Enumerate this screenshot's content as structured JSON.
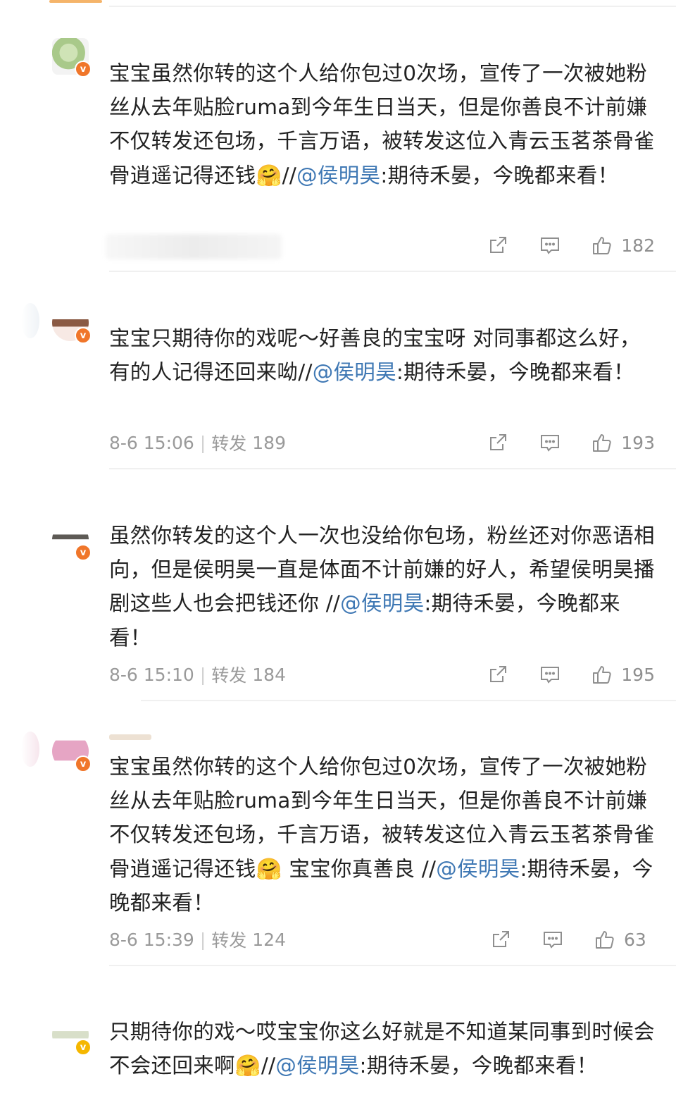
{
  "comments": [
    {
      "text_before": "宝宝虽然你转的这个人给你包过0次场，宣传了一次被她粉丝从去年贴脸ruma到今年生日当天，但是你善良不计前嫌不仅转发还包场，千言万语，被转发这位入青云玉茗茶骨雀骨逍遥记得还钱",
      "emoji": "🤗",
      "text_mid": "",
      "slashes": "//",
      "mention": "@侯明昊",
      "quote": ":期待禾晏，今晚都来看！",
      "time": "",
      "repost_label": "",
      "repost_count": "",
      "likes": "182"
    },
    {
      "text_before": "宝宝只期待你的戏呢～好善良的宝宝呀 对同事都这么好，有的人记得还回来呦",
      "emoji": "",
      "text_mid": "",
      "slashes": "//",
      "mention": "@侯明昊",
      "quote": ":期待禾晏，今晚都来看！",
      "time": "8-6 15:06",
      "repost_label": "转发",
      "repost_count": "189",
      "likes": "193"
    },
    {
      "text_before": "虽然你转发的这个人一次也没给你包场，粉丝还对你恶语相向，但是侯明昊一直是体面不计前嫌的好人，希望侯明昊播剧这些人也会把钱还你 ",
      "emoji": "",
      "text_mid": "",
      "slashes": "//",
      "mention": "@侯明昊",
      "quote": ":期待禾晏，今晚都来看！",
      "time": "8-6 15:10",
      "repost_label": "转发",
      "repost_count": "184",
      "likes": "195"
    },
    {
      "text_before": "宝宝虽然你转的这个人给你包过0次场，宣传了一次被她粉丝从去年贴脸ruma到今年生日当天，但是你善良不计前嫌不仅转发还包场，千言万语，被转发这位入青云玉茗茶骨雀骨逍遥记得还钱",
      "emoji": "🤗",
      "text_mid": " 宝宝你真善良 ",
      "slashes": "//",
      "mention": "@侯明昊",
      "quote": ":期待禾晏，今晚都来看！",
      "time": "8-6 15:39",
      "repost_label": "转发",
      "repost_count": "124",
      "likes": "63"
    },
    {
      "text_before": "只期待你的戏～哎宝宝你这么好就是不知道某同事到时候会不会还回来啊",
      "emoji": "🤗",
      "text_mid": "",
      "slashes": "//",
      "mention": "@侯明昊",
      "quote": ":期待禾晏，今晚都来看！",
      "time": "",
      "repost_label": "",
      "repost_count": "",
      "likes": ""
    }
  ],
  "badge_letter": "v",
  "colors": {
    "mention": "#3f78b4",
    "meta": "#9a9a9a",
    "badge_orange": "#f0762a",
    "badge_gold": "#f5b700"
  }
}
